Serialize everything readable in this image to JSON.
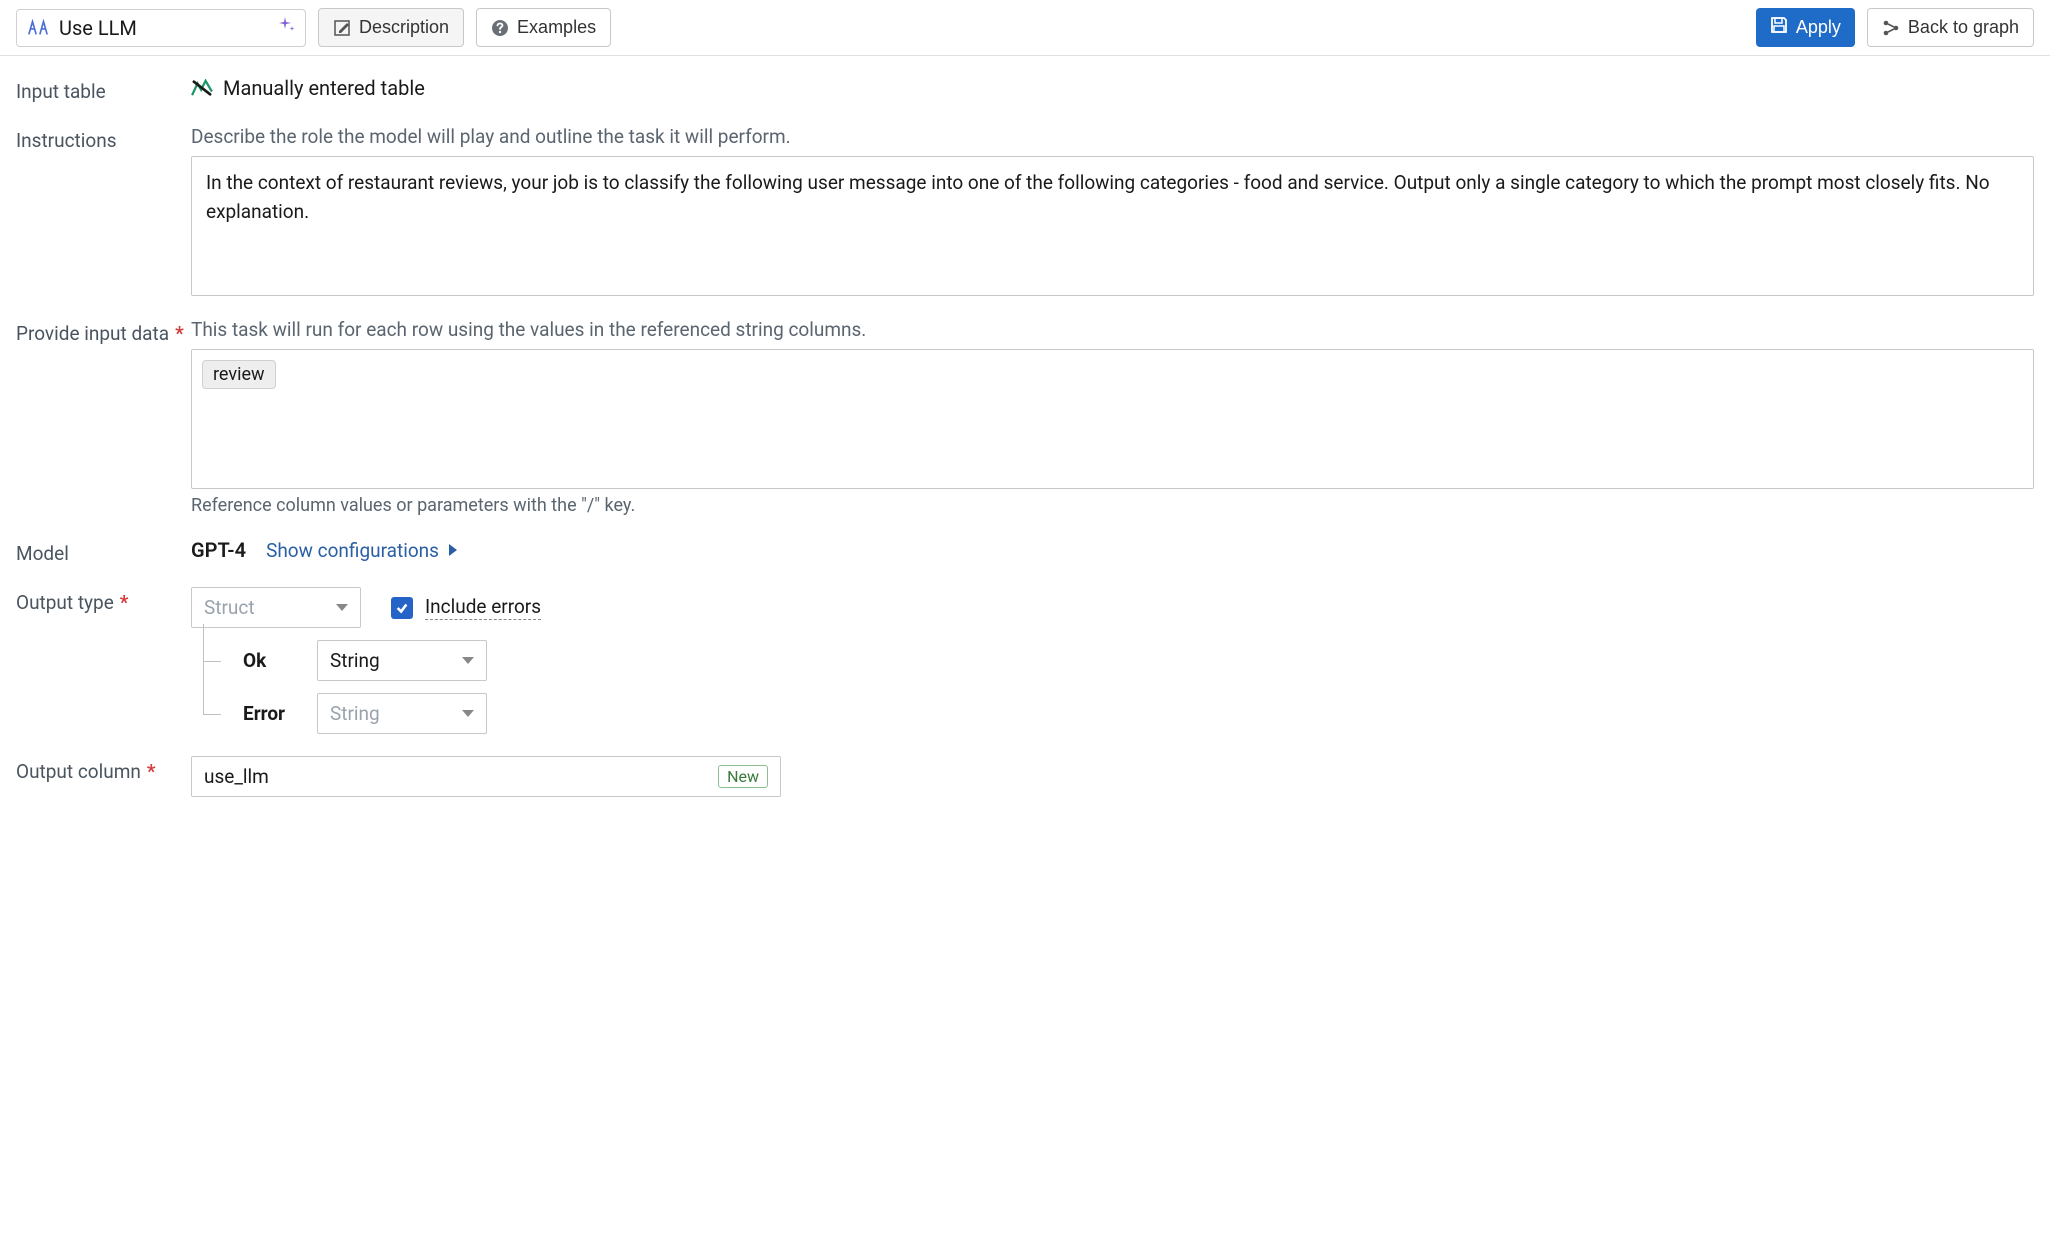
{
  "header": {
    "title": "Use LLM",
    "description_button": "Description",
    "examples_button": "Examples",
    "apply_button": "Apply",
    "back_button": "Back to graph"
  },
  "input_table": {
    "label": "Input table",
    "value": "Manually entered table"
  },
  "instructions": {
    "label": "Instructions",
    "description": "Describe the role the model will play and outline the task it will perform.",
    "value": "In the context of restaurant reviews, your job is to classify the following user message into one of the following categories - food and service. Output only a single category to which the prompt most closely fits. No explanation."
  },
  "input_data": {
    "label": "Provide input data",
    "description": "This task will run for each row using the values in the referenced string columns.",
    "chip": "review",
    "hint": "Reference column values or parameters with the \"/\" key."
  },
  "model": {
    "label": "Model",
    "value": "GPT-4",
    "link": "Show configurations"
  },
  "output_type": {
    "label": "Output type",
    "select_value": "Struct",
    "include_errors": "Include errors",
    "struct": {
      "ok_key": "Ok",
      "ok_type": "String",
      "error_key": "Error",
      "error_type": "String"
    }
  },
  "output_column": {
    "label": "Output column",
    "value": "use_llm",
    "badge": "New"
  }
}
